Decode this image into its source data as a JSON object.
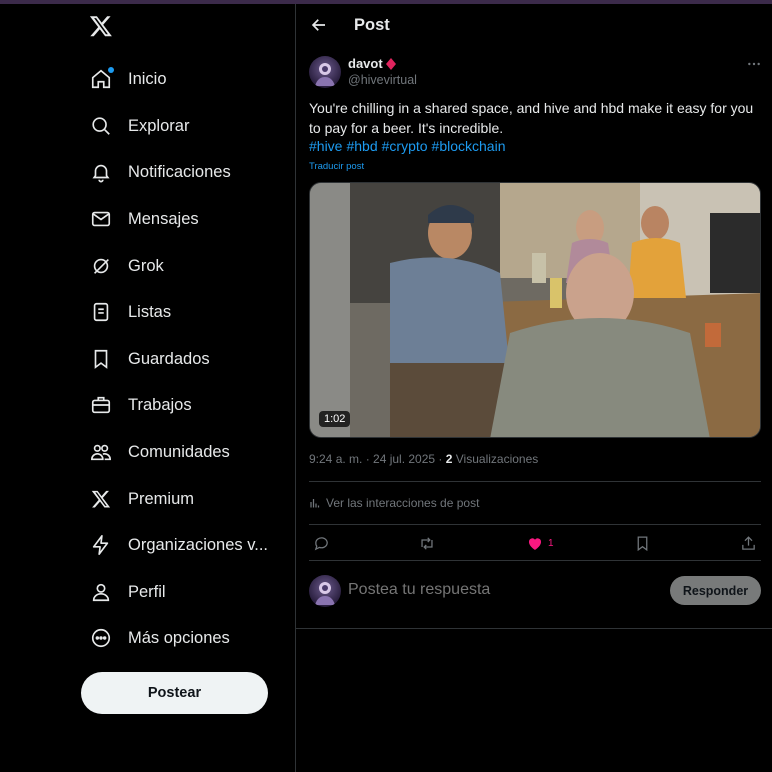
{
  "sidebar": {
    "items": [
      {
        "label": "Inicio",
        "icon": "home-icon",
        "notify": true
      },
      {
        "label": "Explorar",
        "icon": "search-icon"
      },
      {
        "label": "Notificaciones",
        "icon": "bell-icon"
      },
      {
        "label": "Mensajes",
        "icon": "envelope-icon"
      },
      {
        "label": "Grok",
        "icon": "grok-icon"
      },
      {
        "label": "Listas",
        "icon": "list-icon"
      },
      {
        "label": "Guardados",
        "icon": "bookmark-icon"
      },
      {
        "label": "Trabajos",
        "icon": "briefcase-icon"
      },
      {
        "label": "Comunidades",
        "icon": "people-icon"
      },
      {
        "label": "Premium",
        "icon": "x-logo-icon"
      },
      {
        "label": "Organizaciones v...",
        "icon": "lightning-icon"
      },
      {
        "label": "Perfil",
        "icon": "person-icon"
      },
      {
        "label": "Más opciones",
        "icon": "more-circle-icon"
      }
    ],
    "post_button": "Postear"
  },
  "header": {
    "title": "Post"
  },
  "post": {
    "author_name": "davot",
    "author_handle": "@hivevirtual",
    "text": "You're chilling in a shared space, and hive and hbd make it easy for you to pay for a beer. It's incredible.",
    "hashtags": [
      "#hive",
      "#hbd",
      "#crypto",
      "#blockchain"
    ],
    "translate": "Traducir post",
    "video_duration": "1:02",
    "timestamp": "9:24 a. m. · 24 jul. 2025 · ",
    "views_count": "2",
    "views_label": " Visualizaciones",
    "analytics_label": "Ver las interacciones de post",
    "likes": "1"
  },
  "reply": {
    "placeholder": "Postea tu respuesta",
    "button": "Responder"
  },
  "colors": {
    "accent": "#1d9bf0",
    "like": "#f91880",
    "background": "#000000",
    "border": "#2f3336",
    "muted": "#71767b"
  }
}
